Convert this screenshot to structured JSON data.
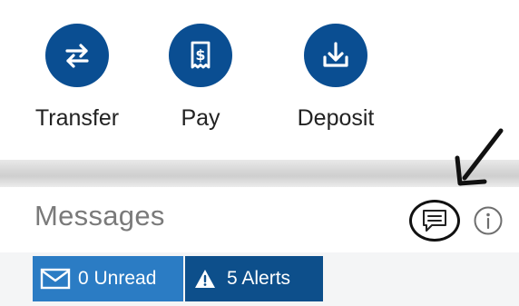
{
  "quick_actions": {
    "transfer_label": "Transfer",
    "transfer_icon": "transfer-arrows-icon",
    "pay_label": "Pay",
    "pay_icon": "bill-dollar-icon",
    "deposit_label": "Deposit",
    "deposit_icon": "download-tray-icon"
  },
  "messages": {
    "title": "Messages",
    "chat_icon": "chat-bubble-icon",
    "info_icon": "info-icon",
    "unread_label": "0 Unread",
    "unread_icon": "envelope-icon",
    "alerts_label": "5 Alerts",
    "alerts_icon": "warning-triangle-icon"
  },
  "colors": {
    "brand_blue": "#0a4e92",
    "unread_pill": "#2b7cc4",
    "alerts_pill": "#0d4f8b",
    "muted_text": "#7a7a7a"
  }
}
